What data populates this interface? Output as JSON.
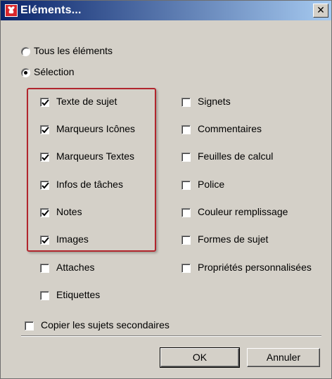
{
  "window": {
    "title": "Eléments...",
    "close_glyph": "✕"
  },
  "scope": {
    "options": [
      {
        "label": "Tous les éléments",
        "selected": false
      },
      {
        "label": "Sélection",
        "selected": true
      }
    ]
  },
  "left_column": [
    {
      "label": "Texte de sujet",
      "checked": true
    },
    {
      "label": "Marqueurs Icônes",
      "checked": true
    },
    {
      "label": "Marqueurs Textes",
      "checked": true
    },
    {
      "label": "Infos de tâches",
      "checked": true
    },
    {
      "label": "Notes",
      "checked": true
    },
    {
      "label": "Images",
      "checked": true
    },
    {
      "label": "Attaches",
      "checked": false
    },
    {
      "label": "Etiquettes",
      "checked": false
    }
  ],
  "right_column": [
    {
      "label": "Signets",
      "checked": false
    },
    {
      "label": "Commentaires",
      "checked": false
    },
    {
      "label": "Feuilles de calcul",
      "checked": false
    },
    {
      "label": "Police",
      "checked": false
    },
    {
      "label": "Couleur remplissage",
      "checked": false
    },
    {
      "label": "Formes de sujet",
      "checked": false
    },
    {
      "label": "Propriétés personnalisées",
      "checked": false
    }
  ],
  "copy_subtopics": {
    "label": "Copier les sujets secondaires",
    "checked": false
  },
  "buttons": {
    "ok": "OK",
    "cancel": "Annuler"
  },
  "colors": {
    "highlight_border": "#b1252d",
    "titlebar_start": "#0a246a",
    "titlebar_end": "#a6caf0",
    "dialog_bg": "#d4d0c8"
  },
  "icons": {
    "app": "mindmap-app-icon",
    "close": "close-icon",
    "check": "check-icon"
  }
}
